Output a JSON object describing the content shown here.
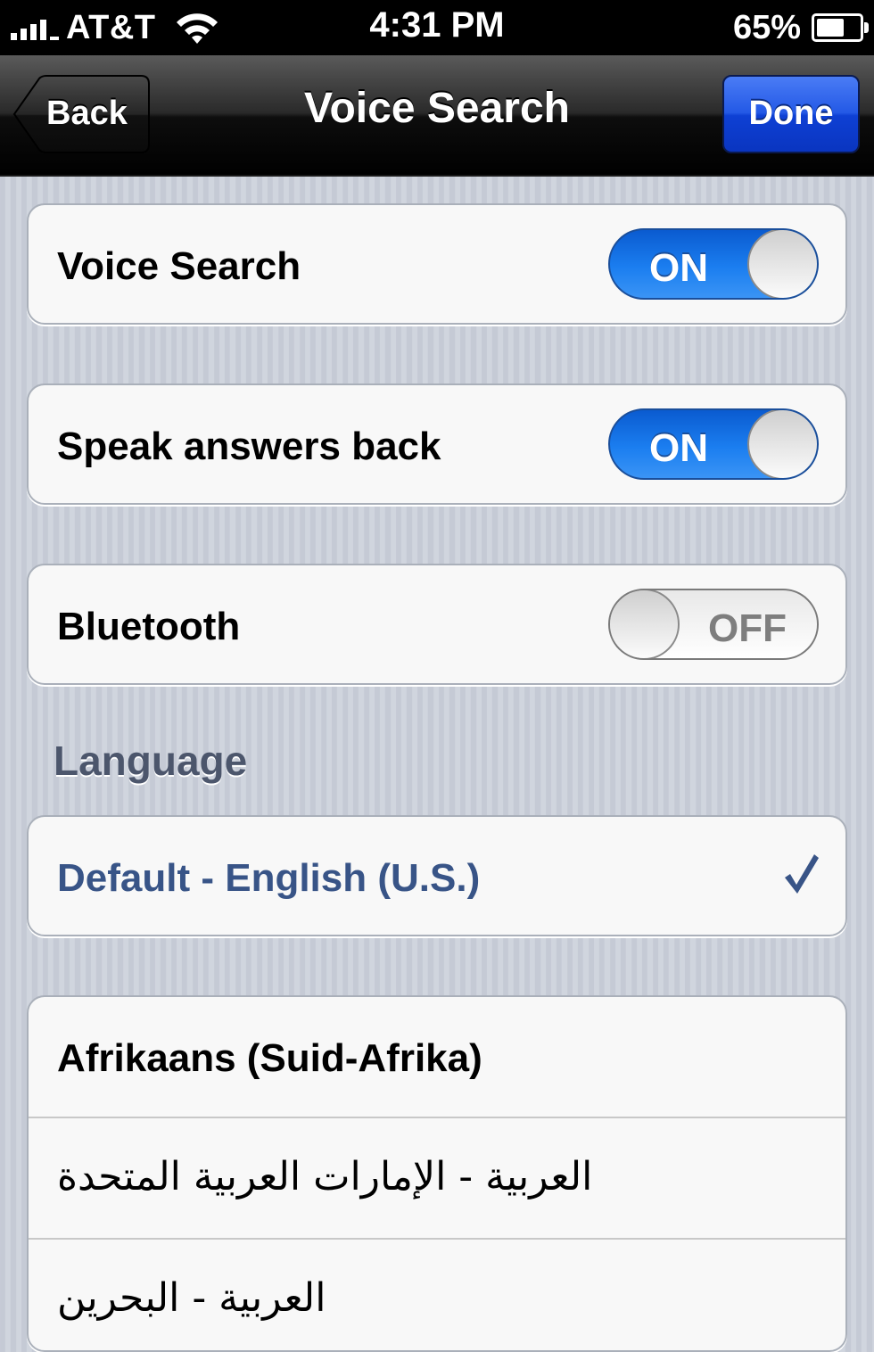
{
  "status_bar": {
    "carrier": "AT&T",
    "time": "4:31 PM",
    "battery_percent": "65%",
    "battery_level": 0.65
  },
  "nav": {
    "back_label": "Back",
    "title": "Voice Search",
    "done_label": "Done"
  },
  "settings": [
    {
      "label": "Voice Search",
      "toggle": "ON",
      "on": true
    },
    {
      "label": "Speak answers back",
      "toggle": "ON",
      "on": true
    },
    {
      "label": "Bluetooth",
      "toggle": "OFF",
      "on": false
    }
  ],
  "language_header": "Language",
  "selected_language": {
    "label": "Default - English (U.S.)",
    "checked": true
  },
  "languages": [
    "Afrikaans (Suid-Afrika)",
    "العربية - الإمارات العربية المتحدة",
    "العربية - البحرين"
  ],
  "colors": {
    "done_button": "#2459e6",
    "toggle_on": "#1b7ef0",
    "selected_text": "#385487",
    "section_header": "#4c566c"
  }
}
